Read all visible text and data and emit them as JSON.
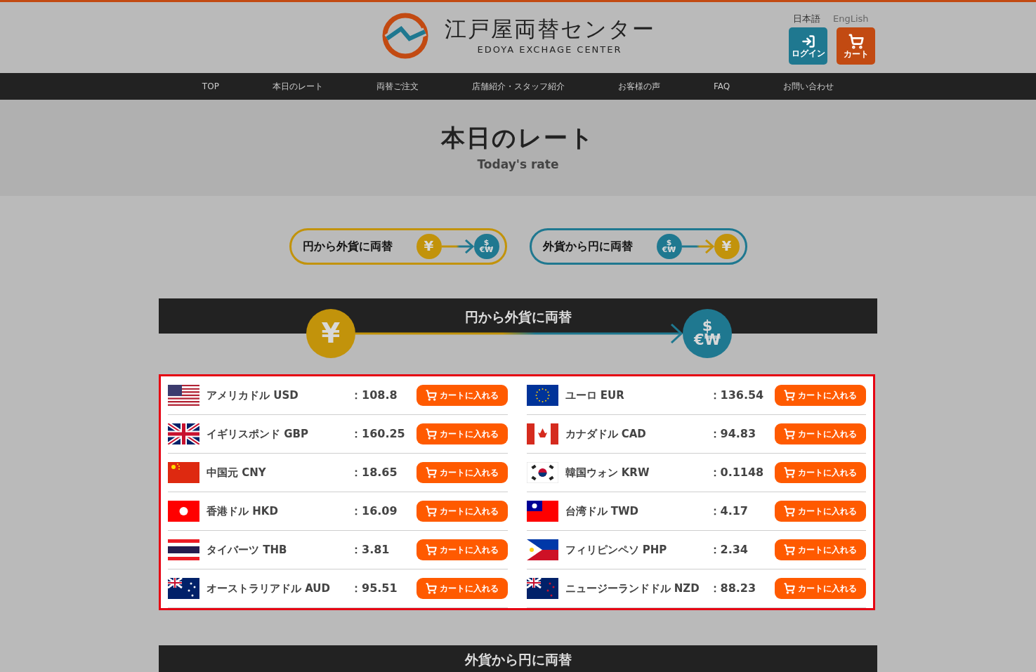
{
  "header": {
    "title": "江戸屋両替センター",
    "subtitle": "EDOYA EXCHAGE CENTER",
    "languages": [
      {
        "label": "日本語",
        "selected": true
      },
      {
        "label": "EngLish",
        "selected": false
      }
    ],
    "actions": [
      {
        "kind": "login",
        "label": "ログイン"
      },
      {
        "kind": "cart",
        "label": "カート"
      }
    ]
  },
  "nav": [
    {
      "label": "TOP"
    },
    {
      "label": "本日のレート"
    },
    {
      "label": "両替ご注文"
    },
    {
      "label": "店舗紹介・スタッフ紹介"
    },
    {
      "label": "お客様の声"
    },
    {
      "label": "FAQ"
    },
    {
      "label": "お問い合わせ"
    }
  ],
  "hero": {
    "title": "本日のレート",
    "subtitle": "Today's rate"
  },
  "direction_buttons": [
    {
      "label": "円から外貨に両替",
      "kind": "yen_to_foreign",
      "from": {
        "kind": "yen",
        "lines": [
          "¥"
        ]
      },
      "to": {
        "kind": "foreign",
        "lines": [
          "$",
          "€₩"
        ]
      }
    },
    {
      "label": "外貨から円に両替",
      "kind": "foreign_to_yen",
      "from": {
        "kind": "foreign",
        "lines": [
          "$",
          "€₩"
        ]
      },
      "to": {
        "kind": "yen",
        "lines": [
          "¥"
        ]
      }
    }
  ],
  "section": {
    "title": "円から外貨に両替",
    "from": {
      "kind": "yen",
      "lines": [
        "¥"
      ]
    },
    "to": {
      "kind": "foreign",
      "lines": [
        "$",
        "€₩"
      ]
    }
  },
  "rates": [
    [
      {
        "kind": "usd",
        "name": "アメリカドル USD",
        "rate": "：108.8",
        "button": "カートに入れる"
      },
      {
        "kind": "gbp",
        "name": "イギリスポンド GBP",
        "rate": "：160.25",
        "button": "カートに入れる"
      },
      {
        "kind": "cny",
        "name": "中国元 CNY",
        "rate": "：18.65",
        "button": "カートに入れる"
      },
      {
        "kind": "hkd",
        "name": "香港ドル HKD",
        "rate": "：16.09",
        "button": "カートに入れる"
      },
      {
        "kind": "thb",
        "name": "タイバーツ THB",
        "rate": "：3.81",
        "button": "カートに入れる"
      },
      {
        "kind": "aud",
        "name": "オーストラリアドル AUD",
        "rate": "：95.51",
        "button": "カートに入れる"
      }
    ],
    [
      {
        "kind": "eur",
        "name": "ユーロ EUR",
        "rate": "：136.54",
        "button": "カートに入れる"
      },
      {
        "kind": "cad",
        "name": "カナダドル CAD",
        "rate": "：94.83",
        "button": "カートに入れる"
      },
      {
        "kind": "krw",
        "name": "韓国ウォン KRW",
        "rate": "：0.1148",
        "button": "カートに入れる"
      },
      {
        "kind": "twd",
        "name": "台湾ドル TWD",
        "rate": "：4.17",
        "button": "カートに入れる"
      },
      {
        "kind": "php",
        "name": "フィリピンペソ PHP",
        "rate": "：2.34",
        "button": "カートに入れる"
      },
      {
        "kind": "nzd",
        "name": "ニュージーランドドル NZD",
        "rate": "：88.23",
        "button": "カートに入れる"
      }
    ]
  ],
  "next_section": {
    "title": "外貨から円に両替"
  }
}
